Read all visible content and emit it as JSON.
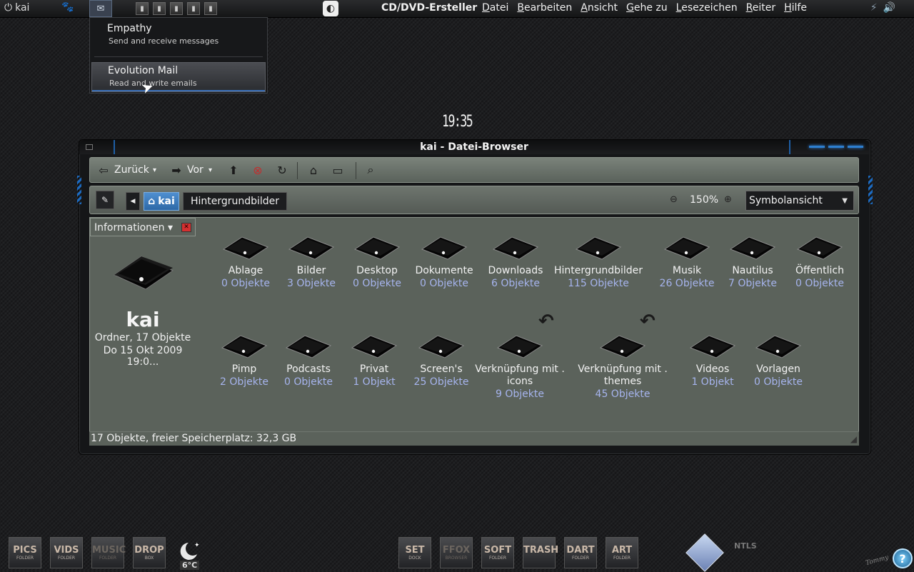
{
  "top_panel": {
    "user": "kai",
    "user_icon": "power-icon",
    "app_name": "CD/DVD-Ersteller",
    "menu": [
      "Datei",
      "Bearbeiten",
      "Ansicht",
      "Gehe zu",
      "Lesezeichen",
      "Reiter",
      "Hilfe"
    ]
  },
  "popup": {
    "items": [
      {
        "title": "Empathy",
        "desc": "Send and receive messages"
      },
      {
        "title": "Evolution Mail",
        "desc": "Read and write emails"
      }
    ]
  },
  "clock": "19:35",
  "window": {
    "title": "kai - Datei-Browser",
    "toolbar": {
      "back": "Zurück",
      "forward": "Vor"
    },
    "location": {
      "home": "kai",
      "folder": "Hintergrundbilder",
      "zoom": "150%",
      "view": "Symbolansicht"
    },
    "sidebar": {
      "title": "Informationen",
      "name": "kai",
      "info1": "Ordner, 17 Objekte",
      "info2": "Do 15 Okt 2009 19:0..."
    },
    "items": [
      {
        "name": "Ablage",
        "count": "0 Objekte"
      },
      {
        "name": "Bilder",
        "count": "3 Objekte"
      },
      {
        "name": "Desktop",
        "count": "0 Objekte"
      },
      {
        "name": "Dokumente",
        "count": "0 Objekte"
      },
      {
        "name": "Downloads",
        "count": "6 Objekte"
      },
      {
        "name": "Hintergrundbilder",
        "count": "115 Objekte"
      },
      {
        "name": "Musik",
        "count": "26 Objekte"
      },
      {
        "name": "Nautilus",
        "count": "7 Objekte"
      },
      {
        "name": "Öffentlich",
        "count": "0 Objekte"
      },
      {
        "name": "Pimp",
        "count": "2 Objekte"
      },
      {
        "name": "Podcasts",
        "count": "0 Objekte"
      },
      {
        "name": "Privat",
        "count": "1 Objekt"
      },
      {
        "name": "Screen's",
        "count": "25 Objekte"
      },
      {
        "name": "Verknüpfung mit .",
        "name2": "icons",
        "count": "9 Objekte"
      },
      {
        "name": "Verknüpfung mit .",
        "name2": "themes",
        "count": "45 Objekte"
      },
      {
        "name": "Videos",
        "count": "1 Objekt"
      },
      {
        "name": "Vorlagen",
        "count": "0 Objekte"
      }
    ],
    "status": "17 Objekte, freier Speicherplatz: 32,3 GB"
  },
  "dock": {
    "left": [
      {
        "big": "PICS",
        "small": "FOLDER"
      },
      {
        "big": "VIDS",
        "small": "FOLDER"
      },
      {
        "big": "MUSIC",
        "small": "FOLDER"
      },
      {
        "big": "DROP",
        "small": "BOX"
      }
    ],
    "weather": "6°C",
    "right": [
      {
        "big": "SET",
        "small": "DOCK"
      },
      {
        "big": "FFOX",
        "small": "BROWSER"
      },
      {
        "big": "SOFT",
        "small": "FOLDER"
      },
      {
        "big": "TRASH",
        "small": ""
      },
      {
        "big": "DART",
        "small": "FOLDER"
      },
      {
        "big": "ART",
        "small": "FOLDER"
      }
    ],
    "ntls": "NTLS",
    "signature": "Tommy"
  },
  "colors": {
    "accent": "#2d7fd0",
    "count_text": "#a6b4ee",
    "pane": "#5b625b"
  }
}
